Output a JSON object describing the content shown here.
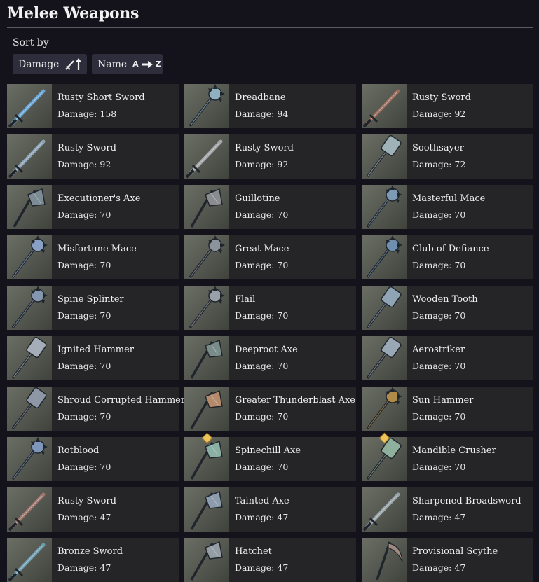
{
  "page": {
    "title": "Melee Weapons",
    "sort_label": "Sort by",
    "sort_damage_label": "Damage",
    "sort_name_label": "Name",
    "sort_name_from": "A",
    "sort_name_to": "Z"
  },
  "weapons": [
    {
      "name": "Rusty Short Sword",
      "damage": "Damage: 158",
      "icon": "sword-icon",
      "color": "#6aa6d8"
    },
    {
      "name": "Dreadbane",
      "damage": "Damage: 94",
      "icon": "mace-icon",
      "color": "#8fb0c0"
    },
    {
      "name": "Rusty Sword",
      "damage": "Damage: 92",
      "icon": "sword-icon",
      "color": "#9c6a5a"
    },
    {
      "name": "Rusty Sword",
      "damage": "Damage: 92",
      "icon": "sword-icon",
      "color": "#8ea4b6"
    },
    {
      "name": "Rusty Sword",
      "damage": "Damage: 92",
      "icon": "sword-icon",
      "color": "#a3a6a8"
    },
    {
      "name": "Soothsayer",
      "damage": "Damage: 72",
      "icon": "hammer-icon",
      "color": "#9fb2b8"
    },
    {
      "name": "Executioner's Axe",
      "damage": "Damage: 70",
      "icon": "axe-icon",
      "color": "#7d8b95"
    },
    {
      "name": "Guillotine",
      "damage": "Damage: 70",
      "icon": "axe-icon",
      "color": "#8a8d90"
    },
    {
      "name": "Masterful Mace",
      "damage": "Damage: 70",
      "icon": "mace-icon",
      "color": "#7e9bb6"
    },
    {
      "name": "Misfortune Mace",
      "damage": "Damage: 70",
      "icon": "mace-icon",
      "color": "#88a0c4"
    },
    {
      "name": "Great Mace",
      "damage": "Damage: 70",
      "icon": "mace-icon",
      "color": "#8b949c"
    },
    {
      "name": "Club of Defiance",
      "damage": "Damage: 70",
      "icon": "mace-icon",
      "color": "#6f8fae"
    },
    {
      "name": "Spine Splinter",
      "damage": "Damage: 70",
      "icon": "mace-icon",
      "color": "#8497ae"
    },
    {
      "name": "Flail",
      "damage": "Damage: 70",
      "icon": "mace-icon",
      "color": "#9aa0a8"
    },
    {
      "name": "Wooden Tooth",
      "damage": "Damage: 70",
      "icon": "hammer-icon",
      "color": "#8fa4b4"
    },
    {
      "name": "Ignited Hammer",
      "damage": "Damage: 70",
      "icon": "hammer-icon",
      "color": "#a5aeb8"
    },
    {
      "name": "Deeproot Axe",
      "damage": "Damage: 70",
      "icon": "axe-icon",
      "color": "#7a8c8a"
    },
    {
      "name": "Aerostriker",
      "damage": "Damage: 70",
      "icon": "hammer-icon",
      "color": "#9aa7b4"
    },
    {
      "name": "Shroud Corrupted Hammer",
      "damage": "Damage: 70",
      "icon": "hammer-icon",
      "color": "#8d97a6"
    },
    {
      "name": "Greater Thunderblast Axe",
      "damage": "Damage: 70",
      "icon": "axe-icon",
      "color": "#b48a6a"
    },
    {
      "name": "Sun Hammer",
      "damage": "Damage: 70",
      "icon": "mace-icon",
      "color": "#b08a48"
    },
    {
      "name": "Rotblood",
      "damage": "Damage: 70",
      "icon": "mace-icon",
      "color": "#7e96ba"
    },
    {
      "name": "Spinechill Axe",
      "damage": "Damage: 70",
      "icon": "axe-icon",
      "color": "#8ab0a4",
      "marked": true
    },
    {
      "name": "Mandible Crusher",
      "damage": "Damage: 70",
      "icon": "hammer-icon",
      "color": "#8eb09c",
      "marked": true
    },
    {
      "name": "Rusty Sword",
      "damage": "Damage: 47",
      "icon": "sword-icon",
      "color": "#a0756a"
    },
    {
      "name": "Tainted Axe",
      "damage": "Damage: 47",
      "icon": "axe-icon",
      "color": "#8c9cac"
    },
    {
      "name": "Sharpened Broadsword",
      "damage": "Damage: 47",
      "icon": "sword-icon",
      "color": "#9aa4aa"
    },
    {
      "name": "Bronze Sword",
      "damage": "Damage: 47",
      "icon": "sword-icon",
      "color": "#6c9cae"
    },
    {
      "name": "Hatchet",
      "damage": "Damage: 47",
      "icon": "axe-icon",
      "color": "#949ca4"
    },
    {
      "name": "Provisional Scythe",
      "damage": "Damage: 47",
      "icon": "scythe-icon",
      "color": "#a08a80"
    }
  ]
}
